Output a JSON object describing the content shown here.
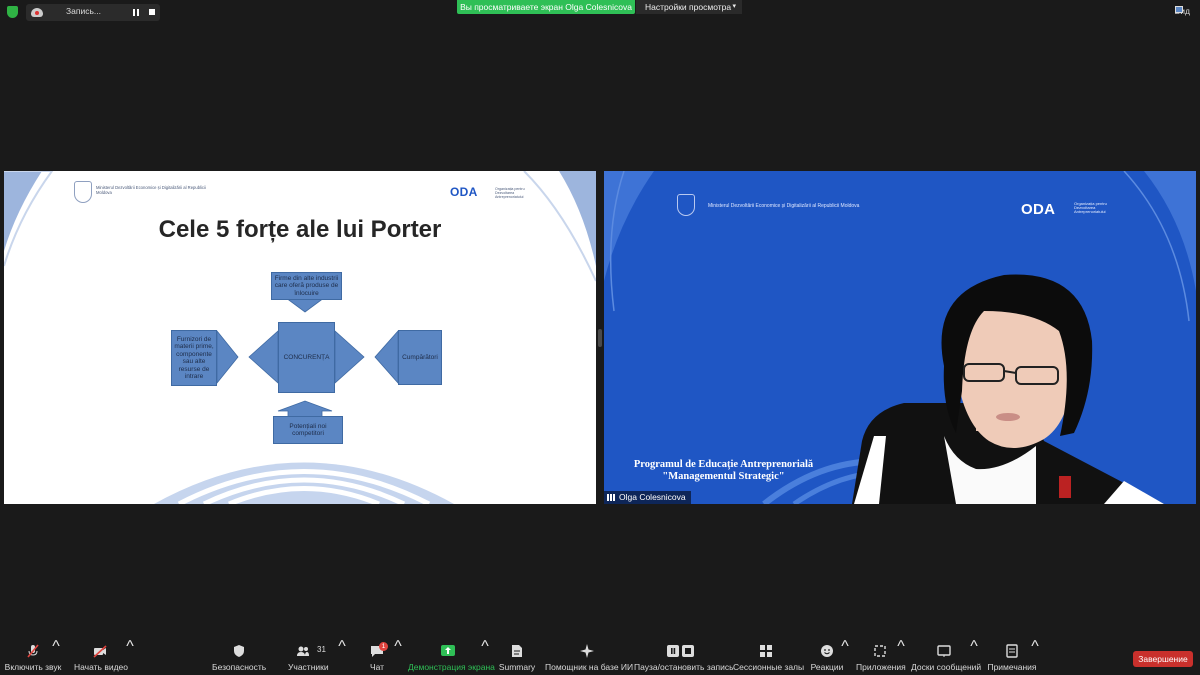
{
  "topbar": {
    "recording_label": "Запись...",
    "viewing_banner": "Вы просматриваете экран Olga Colesnicova",
    "view_options_label": "Настройки просмотра",
    "view_mode_label": "Вид"
  },
  "slide": {
    "ministry_text": "Ministerul Dezvoltării Economice și Digitalizării al Republicii Moldova",
    "oda_logo": "ODA",
    "oda_subtext": "Organizația pentru Dezvoltarea Antreprenoriatului",
    "title": "Cele 5 forțe ale lui Porter",
    "boxes": {
      "top": "Firme din alte industrii care oferă produse de înlocuire",
      "left": "Furnizori de materii prime, componente sau alte resurse de intrare",
      "center": "CONCURENȚA",
      "right": "Cumpărători",
      "bottom": "Potențiali noi competitori"
    }
  },
  "video": {
    "ministry_text": "Ministerul Dezvoltării Economice și Digitalizării al Republicii Moldova",
    "oda_logo": "ODA",
    "oda_subtext": "Organizația pentru Dezvoltarea Antreprenoriatului",
    "program_line1": "Programul de Educație Antreprenorială",
    "program_line2": "\"Managementul Strategic\"",
    "participant_name": "Olga Colesnicova"
  },
  "toolbar": {
    "unmute": "Включить звук",
    "start_video": "Начать видео",
    "security": "Безопасность",
    "participants": "Участники",
    "participants_count": "31",
    "chat": "Чат",
    "chat_badge": "1",
    "share_screen": "Демонстрация экрана",
    "summary": "Summary",
    "ai_assistant": "Помощник на базе ИИ",
    "pause_recording": "Пауза/остановить запись",
    "breakout_rooms": "Сессионные залы",
    "reactions": "Реакции",
    "apps": "Приложения",
    "whiteboards": "Доски сообщений",
    "notes": "Примечания",
    "end": "Завершение"
  },
  "colors": {
    "background": "#1a1a1a",
    "share_green": "#2fbf56",
    "end_red": "#c9302c",
    "video_blue": "#1f56c4",
    "diagram_blue": "#5b86c3"
  }
}
